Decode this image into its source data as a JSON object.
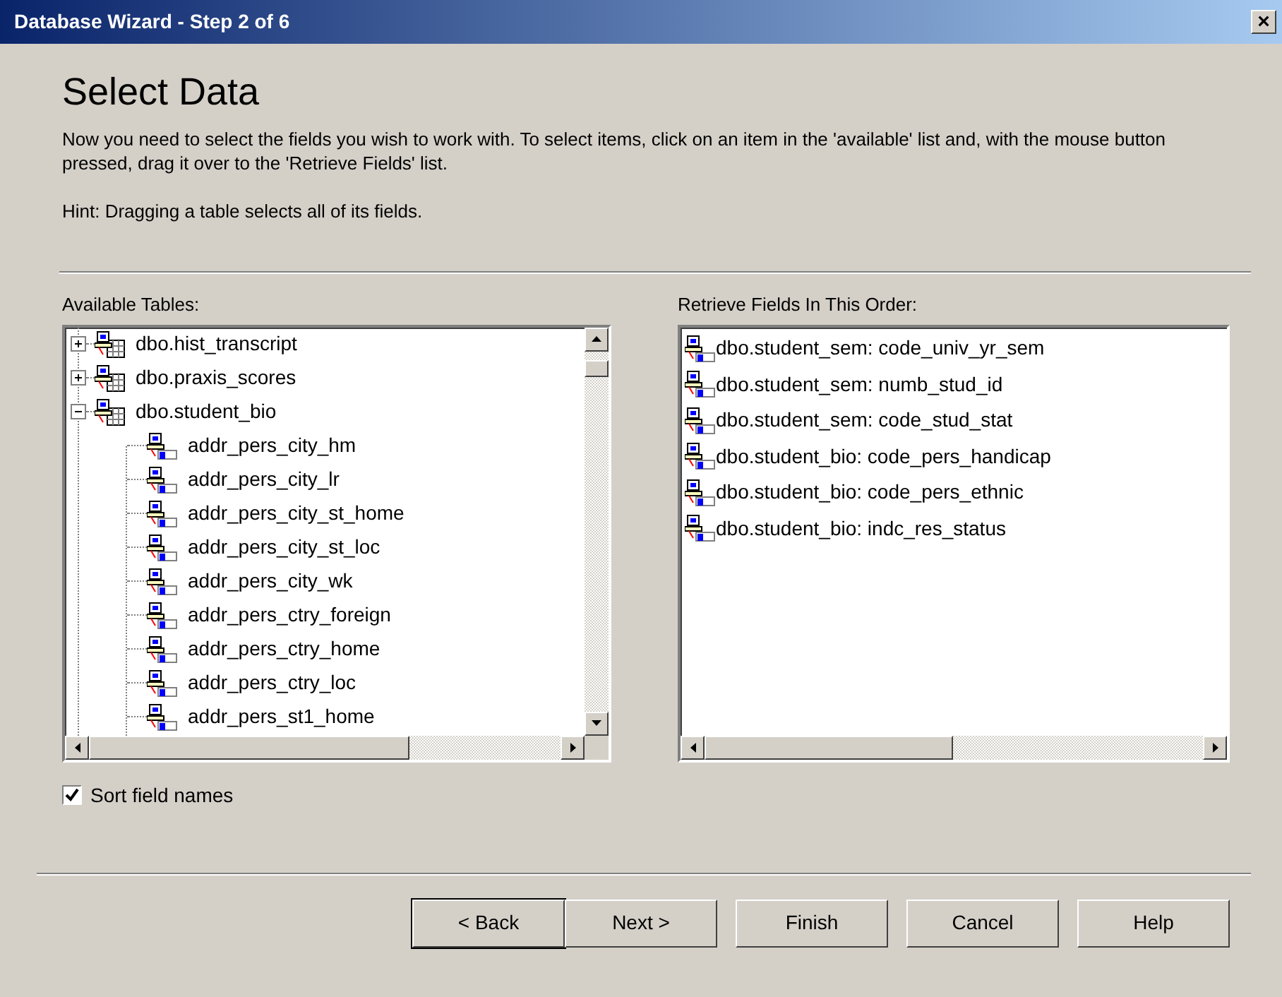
{
  "window": {
    "title": "Database Wizard - Step 2 of 6",
    "close": "×"
  },
  "heading": "Select Data",
  "instructions": "Now you need to select the fields you wish to work with. To select items, click on an item in the 'available' list and, with the mouse button pressed, drag it over to the 'Retrieve Fields' list.",
  "hint": "Hint: Dragging a table selects all of its fields.",
  "available": {
    "label": "Available Tables:",
    "items": [
      {
        "kind": "table",
        "text": "dbo.hist_transcript",
        "expanded": false
      },
      {
        "kind": "table",
        "text": "dbo.praxis_scores",
        "expanded": false
      },
      {
        "kind": "table",
        "text": "dbo.student_bio",
        "expanded": true,
        "children": [
          {
            "kind": "field",
            "text": "addr_pers_city_hm"
          },
          {
            "kind": "field",
            "text": "addr_pers_city_lr"
          },
          {
            "kind": "field",
            "text": "addr_pers_city_st_home"
          },
          {
            "kind": "field",
            "text": "addr_pers_city_st_loc"
          },
          {
            "kind": "field",
            "text": "addr_pers_city_wk"
          },
          {
            "kind": "field",
            "text": "addr_pers_ctry_foreign"
          },
          {
            "kind": "field",
            "text": "addr_pers_ctry_home"
          },
          {
            "kind": "field",
            "text": "addr_pers_ctry_loc"
          },
          {
            "kind": "field",
            "text": "addr_pers_st1_home"
          }
        ]
      }
    ]
  },
  "retrieve": {
    "label": "Retrieve Fields In This Order:",
    "items": [
      "dbo.student_sem: code_univ_yr_sem",
      "dbo.student_sem: numb_stud_id",
      "dbo.student_sem: code_stud_stat",
      "dbo.student_bio: code_pers_handicap",
      "dbo.student_bio: code_pers_ethnic",
      "dbo.student_bio: indc_res_status"
    ]
  },
  "sort_checkbox": {
    "label": "Sort field names",
    "checked": true
  },
  "buttons": [
    {
      "label": "< Back",
      "default": true
    },
    {
      "label": "Next >",
      "default": false
    },
    {
      "label": "Finish",
      "default": false
    },
    {
      "label": "Cancel",
      "default": false
    },
    {
      "label": "Help",
      "default": false
    }
  ]
}
